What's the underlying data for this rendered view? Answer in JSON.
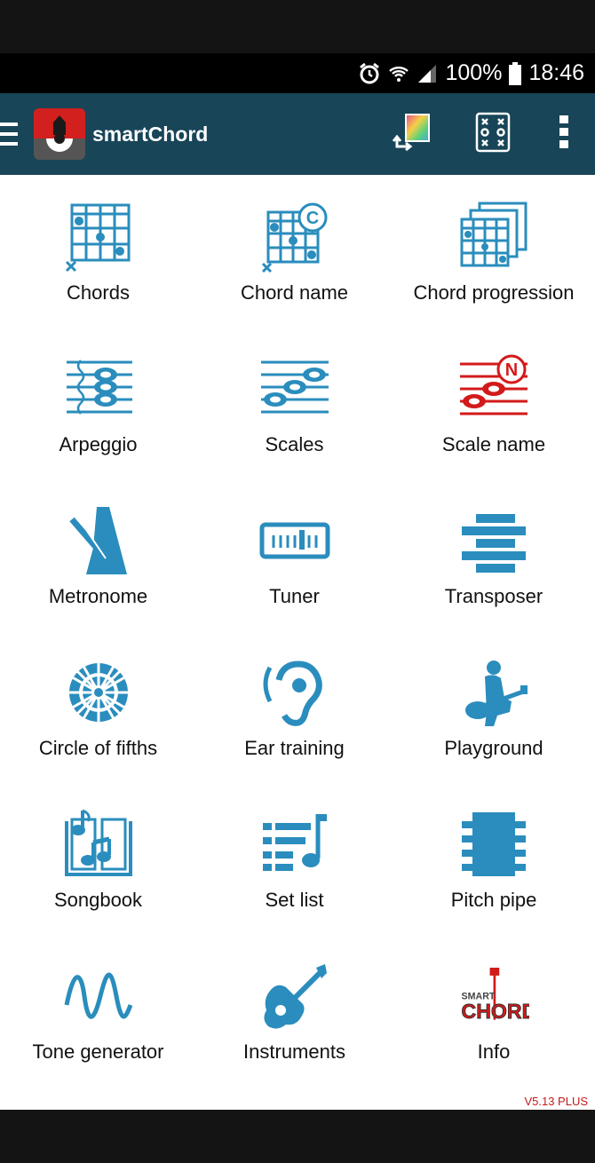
{
  "status_bar": {
    "battery": "100%",
    "time": "18:46",
    "icons": [
      "alarm-icon",
      "wifi-icon",
      "signal-icon",
      "battery-icon"
    ]
  },
  "app_bar": {
    "title": "smartChord",
    "actions": [
      "switch-instrument-icon",
      "grid-view-icon",
      "more-vert-icon"
    ]
  },
  "colors": {
    "appbar": "#184558",
    "icon_blue": "#2a8dbd",
    "icon_red": "#d31a1a",
    "version_red": "#c21a1a"
  },
  "tiles": [
    {
      "label": "Chords",
      "icon": "chord-diagram-icon"
    },
    {
      "label": "Chord name",
      "icon": "chord-name-icon"
    },
    {
      "label": "Chord progression",
      "icon": "chord-progression-icon"
    },
    {
      "label": "Arpeggio",
      "icon": "arpeggio-icon"
    },
    {
      "label": "Scales",
      "icon": "scales-icon"
    },
    {
      "label": "Scale name",
      "icon": "scale-name-icon"
    },
    {
      "label": "Metronome",
      "icon": "metronome-icon"
    },
    {
      "label": "Tuner",
      "icon": "tuner-icon"
    },
    {
      "label": "Transposer",
      "icon": "transposer-icon"
    },
    {
      "label": "Circle of fifths",
      "icon": "circle-of-fifths-icon"
    },
    {
      "label": "Ear training",
      "icon": "ear-icon"
    },
    {
      "label": "Playground",
      "icon": "guitarist-icon"
    },
    {
      "label": "Songbook",
      "icon": "songbook-icon"
    },
    {
      "label": "Set list",
      "icon": "set-list-icon"
    },
    {
      "label": "Pitch pipe",
      "icon": "pitch-pipe-icon"
    },
    {
      "label": "Tone generator",
      "icon": "sine-wave-icon"
    },
    {
      "label": "Instruments",
      "icon": "guitar-icon"
    },
    {
      "label": "Info",
      "icon": "smartchord-logo"
    }
  ],
  "version": "V5.13 PLUS"
}
